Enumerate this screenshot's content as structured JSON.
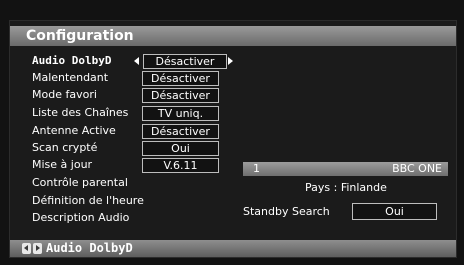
{
  "header": {
    "title": "Configuration"
  },
  "menu": {
    "items": [
      {
        "label": "Audio DolbyD",
        "value": "Désactiver"
      },
      {
        "label": "Malentendant",
        "value": "Désactiver"
      },
      {
        "label": "Mode favori",
        "value": "Désactiver"
      },
      {
        "label": "Liste des Chaînes",
        "value": "TV uniq."
      },
      {
        "label": "Antenne Active",
        "value": "Désactiver"
      },
      {
        "label": "Scan crypté",
        "value": "Oui"
      },
      {
        "label": "Mise à jour",
        "value": "V.6.11"
      },
      {
        "label": "Contrôle parental"
      },
      {
        "label": "Définition de l'heure"
      },
      {
        "label": "Description Audio"
      }
    ]
  },
  "info": {
    "channel_number": "1",
    "channel_name": "BBC ONE",
    "country": "Pays : Finlande",
    "standby_label": "Standby Search",
    "standby_value": "Oui"
  },
  "footer": {
    "text": "Audio DolbyD"
  },
  "colors": {
    "background": "#121212",
    "bar": "#8a8a8a",
    "text": "#ffffff"
  }
}
